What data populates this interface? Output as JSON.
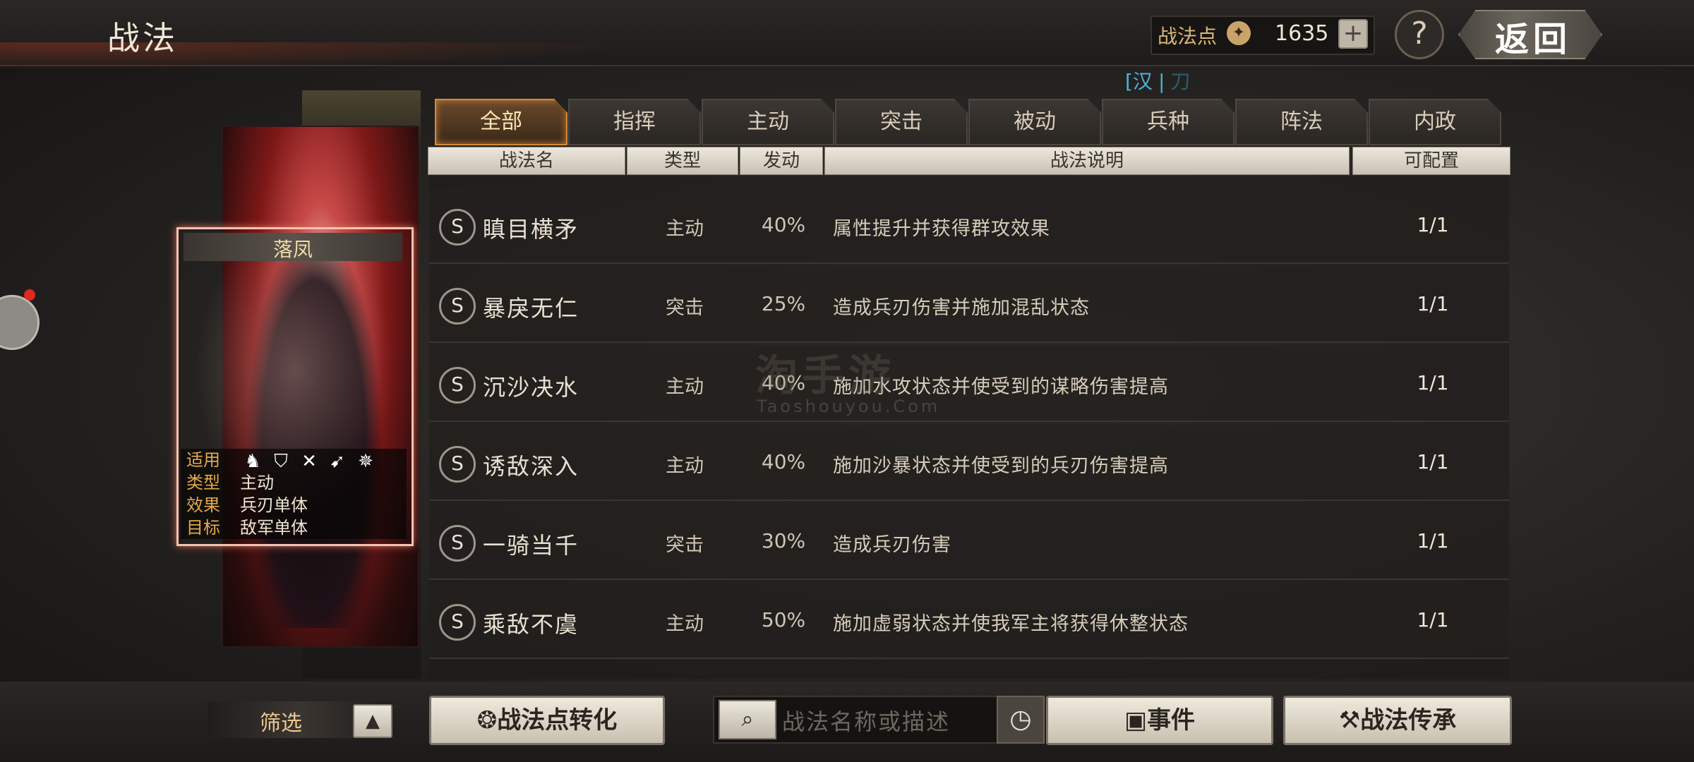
{
  "header": {
    "title": "战法",
    "points_label": "战法点",
    "points_value": "1635",
    "plus_label": "+",
    "help_label": "?",
    "back_label": "返回"
  },
  "faction_filter": {
    "active": "[汉",
    "separator": "|",
    "inactive": "刀"
  },
  "tabs": [
    "全部",
    "指挥",
    "主动",
    "突击",
    "被动",
    "兵种",
    "阵法",
    "内政"
  ],
  "columns": {
    "name": "战法名",
    "type": "类型",
    "rate": "发动",
    "desc": "战法说明",
    "count": "可配置"
  },
  "rows": [
    {
      "badge": "S",
      "name": "瞋目横矛",
      "type": "主动",
      "rate": "40%",
      "desc": "属性提升并获得群攻效果",
      "count": "1/1"
    },
    {
      "badge": "S",
      "name": "暴戾无仁",
      "type": "突击",
      "rate": "25%",
      "desc": "造成兵刃伤害并施加混乱状态",
      "count": "1/1"
    },
    {
      "badge": "S",
      "name": "沉沙决水",
      "type": "主动",
      "rate": "40%",
      "desc": "施加水攻状态并使受到的谋略伤害提高",
      "count": "1/1"
    },
    {
      "badge": "S",
      "name": "诱敌深入",
      "type": "主动",
      "rate": "40%",
      "desc": "施加沙暴状态并使受到的兵刃伤害提高",
      "count": "1/1"
    },
    {
      "badge": "S",
      "name": "一骑当千",
      "type": "突击",
      "rate": "30%",
      "desc": "造成兵刃伤害",
      "count": "1/1"
    },
    {
      "badge": "S",
      "name": "乘敌不虞",
      "type": "主动",
      "rate": "50%",
      "desc": "施加虚弱状态并使我军主将获得休整状态",
      "count": "1/1"
    }
  ],
  "selected_card": {
    "name": "落凤",
    "apply_label": "适用",
    "type_label": "类型",
    "type_value": "主动",
    "effect_label": "效果",
    "effect_value": "兵刃单体",
    "target_label": "目标",
    "target_value": "敌军单体",
    "unit_icons": [
      "cavalry-icon",
      "shield-icon",
      "archer-icon",
      "spear-icon",
      "siege-icon"
    ]
  },
  "watermark": {
    "main": "淘手游",
    "sub": "Taoshouyou.Com"
  },
  "bottom": {
    "filter_label": "筛选",
    "filter_toggle": "▲",
    "convert_label": "战法点转化",
    "search_placeholder": "战法名称或描述",
    "event_label": "事件",
    "inherit_label": "战法传承"
  },
  "colors": {
    "active_tab": "#d58a3a",
    "faction_active": "#4fb3d9",
    "info_key": "#e3a94c",
    "card_frame": "#f2c3b4"
  }
}
